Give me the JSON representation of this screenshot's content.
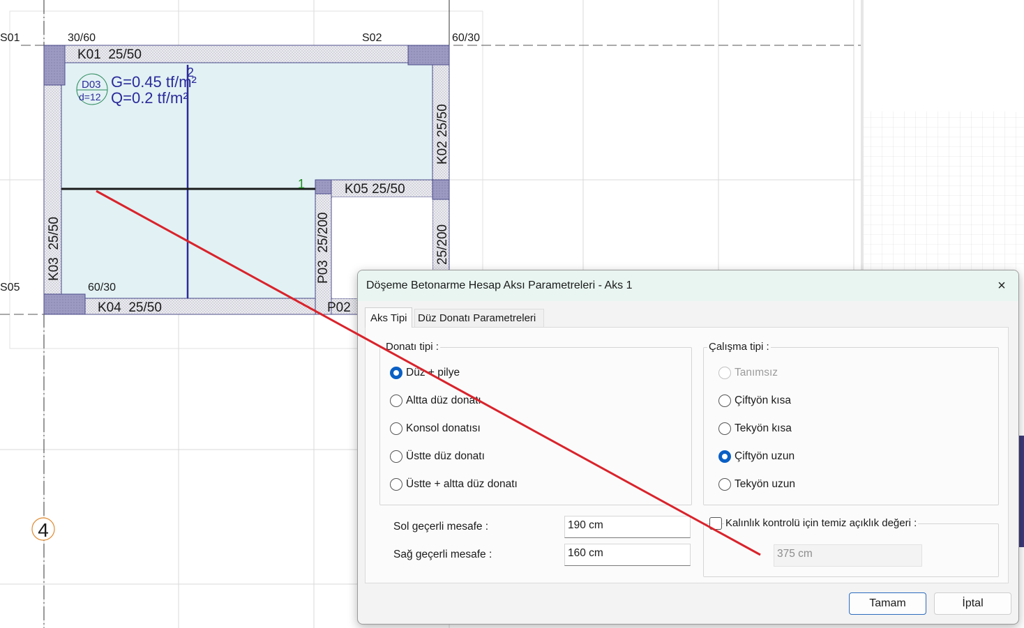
{
  "drawing": {
    "axis_labels": {
      "s01": "S01",
      "s02": "S02",
      "s05": "S05",
      "col_30_60": "30/60",
      "col_60_30_top": "60/30",
      "col_60_30_bottom": "60/30",
      "axis_4": "4"
    },
    "beams": {
      "k01": "K01  25/50",
      "k02": "K02 25/50",
      "k03": "K03  25/50",
      "k04": "K04  25/50",
      "k05": "K05 25/50",
      "p03": "P03  25/200",
      "p02": "P02",
      "right_wall": "25/200"
    },
    "slab": {
      "id": "D03",
      "thickness": "d=12",
      "load_g": "G=0.45 tf/m²",
      "load_q": "Q=0.2 tf/m²"
    },
    "axis_markers": {
      "one": "1",
      "two": "2"
    }
  },
  "colors": {
    "slab_fill": "#e2f1f4",
    "beam_fill": "#ececf0",
    "column_fill": "#9c9ac2",
    "beam_outline": "#4a4a8a",
    "annotation_blue": "#2b2b9a",
    "axis_line": "#d4d4d4",
    "red_line": "#d9232b",
    "marker_green": "#1c8a1c",
    "accent": "#0a5fc4"
  },
  "dialog": {
    "title": "Döşeme Betonarme Hesap Aksı Parametreleri - Aks 1",
    "close_icon": "×",
    "tabs": [
      {
        "label": "Aks Tipi",
        "active": true
      },
      {
        "label": "Düz Donatı Parametreleri",
        "active": false
      }
    ],
    "donati_group": {
      "label": "Donatı tipi :",
      "options": [
        {
          "label": "Düz + pilye",
          "selected": true
        },
        {
          "label": "Altta düz donatı",
          "selected": false
        },
        {
          "label": "Konsol donatısı",
          "selected": false
        },
        {
          "label": "Üstte düz donatı",
          "selected": false
        },
        {
          "label": "Üstte + altta düz donatı",
          "selected": false
        }
      ]
    },
    "calisma_group": {
      "label": "Çalışma tipi :",
      "options": [
        {
          "label": "Tanımsız",
          "selected": false,
          "disabled": true
        },
        {
          "label": "Çiftyön kısa",
          "selected": false,
          "disabled": false
        },
        {
          "label": "Tekyön kısa",
          "selected": false,
          "disabled": false
        },
        {
          "label": "Çiftyön uzun",
          "selected": true,
          "disabled": false
        },
        {
          "label": "Tekyön uzun",
          "selected": false,
          "disabled": false
        }
      ]
    },
    "sol_label": "Sol geçerli mesafe :",
    "sol_value": "190 cm",
    "sag_label": "Sağ geçerli mesafe :",
    "sag_value": "160 cm",
    "kalinlik_label": "Kalınlık kontrolü için temiz açıklık değeri :",
    "kalinlik_checked": false,
    "kalinlik_value": "375 cm",
    "ok_label": "Tamam",
    "cancel_label": "İptal"
  }
}
